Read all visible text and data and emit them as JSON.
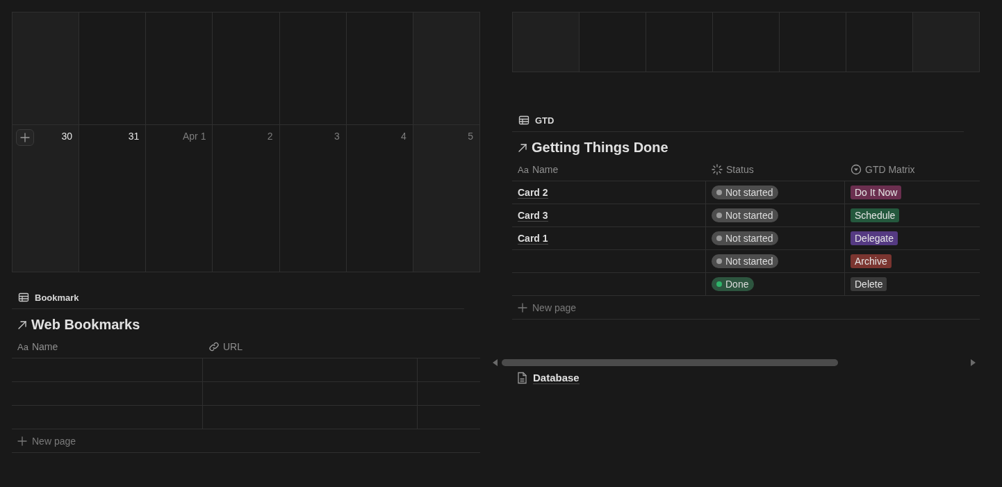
{
  "calendar": {
    "days": [
      {
        "label": "30",
        "in_month": true
      },
      {
        "label": "31",
        "in_month": true
      },
      {
        "label": "Apr 1",
        "in_month": false
      },
      {
        "label": "2",
        "in_month": false
      },
      {
        "label": "3",
        "in_month": false
      },
      {
        "label": "4",
        "in_month": false
      },
      {
        "label": "5",
        "in_month": false
      }
    ]
  },
  "bookmark_view": {
    "view_label": "Bookmark",
    "title": "Web Bookmarks",
    "columns": [
      {
        "label": "Name",
        "kind": "title",
        "icon_text": "Aa"
      },
      {
        "label": "URL",
        "kind": "url"
      }
    ],
    "new_page": "New page"
  },
  "gtd_view": {
    "view_label": "GTD",
    "title": "Getting Things Done",
    "columns": [
      {
        "label": "Name",
        "kind": "title",
        "icon_text": "Aa"
      },
      {
        "label": "Status",
        "kind": "status"
      },
      {
        "label": "GTD Matrix",
        "kind": "select"
      }
    ],
    "rows": [
      {
        "name": "Card 2",
        "status": {
          "label": "Not started",
          "color": "#9b9b9b"
        },
        "matrix": {
          "label": "Do It Now",
          "color": "#6b2f4f"
        }
      },
      {
        "name": "Card 3",
        "status": {
          "label": "Not started",
          "color": "#9b9b9b"
        },
        "matrix": {
          "label": "Schedule",
          "color": "#24583d"
        }
      },
      {
        "name": "Card 1",
        "status": {
          "label": "Not started",
          "color": "#9b9b9b"
        },
        "matrix": {
          "label": "Delegate",
          "color": "#553a82"
        }
      },
      {
        "status": {
          "label": "Not started",
          "color": "#9b9b9b"
        },
        "matrix": {
          "label": "Archive",
          "color": "#7b3530"
        }
      },
      {
        "status": {
          "label": "Done",
          "color": "#2fb46a"
        },
        "matrix": {
          "label": "Delete",
          "color": "#3b3b3b"
        }
      }
    ],
    "new_page": "New page"
  },
  "linked_page": {
    "title": "Database"
  }
}
